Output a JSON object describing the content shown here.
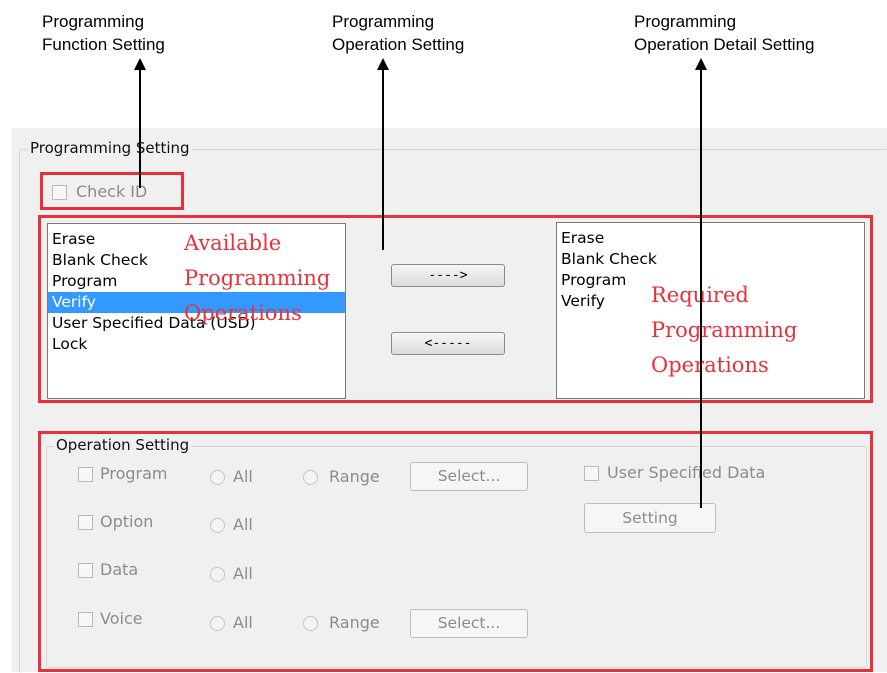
{
  "callouts": {
    "function_setting": "Programming\nFunction Setting",
    "operation_setting": "Programming\nOperation Setting",
    "operation_detail_setting": "Programming\nOperation Detail Setting"
  },
  "programming_setting": {
    "title": "Programming Setting",
    "check_id_label": "Check ID",
    "available_list": [
      "Erase",
      "Blank Check",
      "Program",
      "Verify",
      "User Specified Data (USD)",
      "Lock"
    ],
    "selected_item": "Verify",
    "required_list": [
      "Erase",
      "Blank Check",
      "Program",
      "Verify"
    ],
    "add_button": "---->",
    "remove_button": "<-----",
    "available_annotation": "Available\nProgramming\nOperations",
    "required_annotation": "Required\nProgramming\nOperations"
  },
  "operation_setting": {
    "title": "Operation Setting",
    "rows": [
      {
        "label": "Program",
        "all": "All",
        "range": "Range",
        "select": "Select..."
      },
      {
        "label": "Option",
        "all": "All"
      },
      {
        "label": "Data",
        "all": "All"
      },
      {
        "label": "Voice",
        "all": "All",
        "range": "Range",
        "select": "Select..."
      }
    ],
    "usd_label": "User Specified Data",
    "setting_button": "Setting"
  },
  "colors": {
    "highlight_red": "#e8313a",
    "selection_blue": "#3399ff"
  }
}
